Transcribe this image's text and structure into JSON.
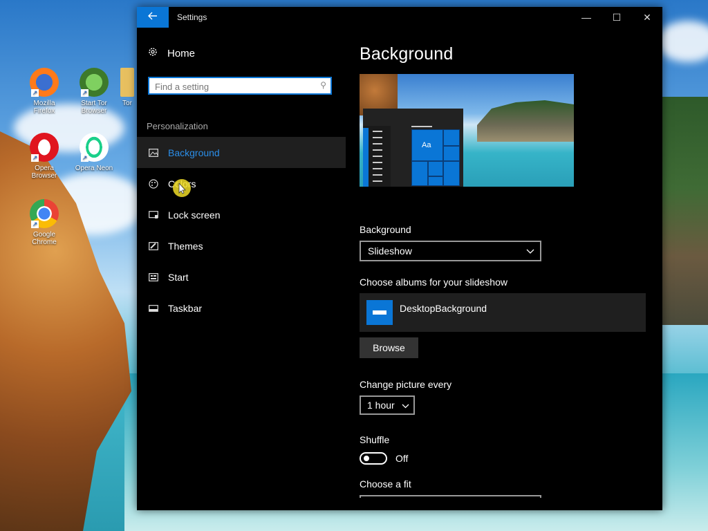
{
  "desktop": {
    "icons": [
      {
        "label": "Mozilla Firefox"
      },
      {
        "label": "Start Tor Browser"
      },
      {
        "label": "Tor"
      },
      {
        "label": "Opera Browser"
      },
      {
        "label": "Opera Neon"
      },
      {
        "label": "Google Chrome"
      }
    ]
  },
  "window": {
    "title": "Settings",
    "controls": {
      "minimize": "—",
      "maximize": "☐",
      "close": "✕"
    }
  },
  "nav": {
    "home_label": "Home",
    "search_placeholder": "Find a setting",
    "section": "Personalization",
    "items": [
      {
        "label": "Background",
        "icon": "image-icon",
        "selected": true
      },
      {
        "label": "Colors",
        "icon": "palette-icon"
      },
      {
        "label": "Lock screen",
        "icon": "lock-screen-icon"
      },
      {
        "label": "Themes",
        "icon": "themes-icon"
      },
      {
        "label": "Start",
        "icon": "start-icon"
      },
      {
        "label": "Taskbar",
        "icon": "taskbar-icon"
      }
    ]
  },
  "content": {
    "title": "Background",
    "preview": {
      "tile_text": "Aa"
    },
    "background_label": "Background",
    "background_value": "Slideshow",
    "albums_label": "Choose albums for your slideshow",
    "album_name": "DesktopBackground",
    "browse_label": "Browse",
    "interval_label": "Change picture every",
    "interval_value": "1 hour",
    "shuffle_label": "Shuffle",
    "shuffle_state": "Off",
    "fit_label": "Choose a fit"
  },
  "colors": {
    "accent": "#0a76d6",
    "window_bg": "#000000",
    "selected_bg": "#1f1f1f"
  }
}
